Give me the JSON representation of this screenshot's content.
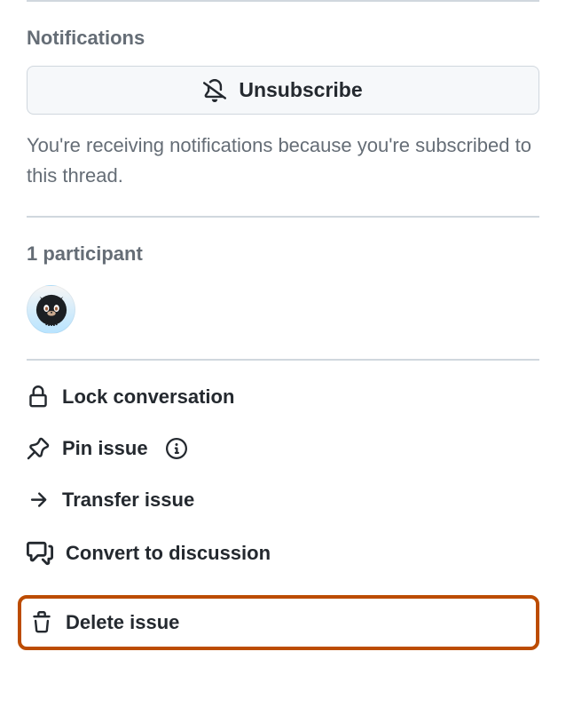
{
  "notifications": {
    "title": "Notifications",
    "unsubscribe_label": "Unsubscribe",
    "reason": "You're receiving notifications because you're subscribed to this thread."
  },
  "participants": {
    "title": "1 participant"
  },
  "actions": {
    "lock_label": "Lock conversation",
    "pin_label": "Pin issue",
    "transfer_label": "Transfer issue",
    "convert_label": "Convert to discussion",
    "delete_label": "Delete issue"
  },
  "colors": {
    "highlight": "#bc4c00",
    "text_muted": "#656d76",
    "text": "#24292f",
    "border": "#d0d7de"
  }
}
